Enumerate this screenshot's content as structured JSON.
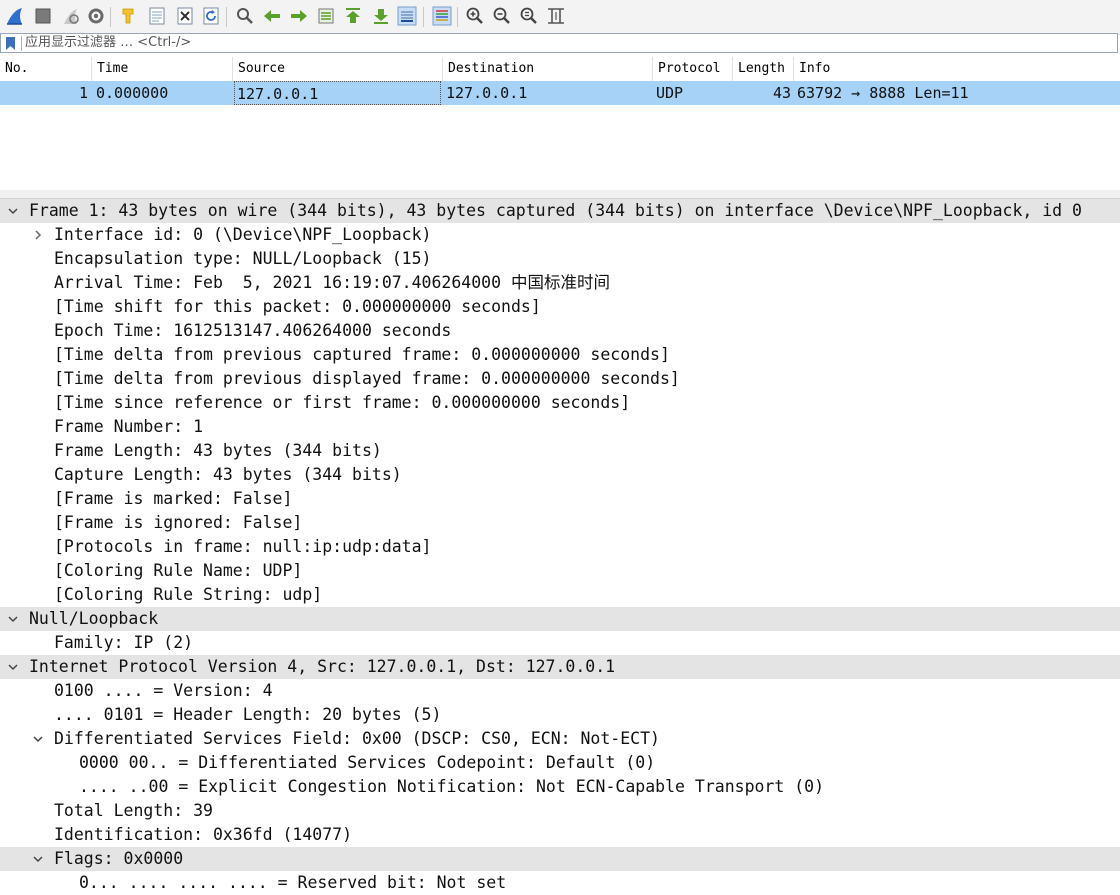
{
  "toolbar": {
    "buttons": [
      {
        "name": "start-capture-icon"
      },
      {
        "name": "stop-capture-icon"
      },
      {
        "name": "restart-capture-icon"
      },
      {
        "name": "capture-options-icon"
      },
      {
        "name": "open-file-icon"
      },
      {
        "name": "save-file-icon"
      },
      {
        "name": "close-file-icon"
      },
      {
        "name": "reload-file-icon"
      },
      {
        "name": "find-packet-icon"
      },
      {
        "name": "go-back-icon"
      },
      {
        "name": "go-forward-icon"
      },
      {
        "name": "go-to-packet-icon"
      },
      {
        "name": "go-first-packet-icon"
      },
      {
        "name": "go-last-packet-icon"
      },
      {
        "name": "auto-scroll-icon"
      },
      {
        "name": "colorize-icon"
      },
      {
        "name": "zoom-in-icon"
      },
      {
        "name": "zoom-out-icon"
      },
      {
        "name": "normal-size-icon"
      },
      {
        "name": "resize-columns-icon"
      }
    ]
  },
  "filter": {
    "placeholder": "应用显示过滤器 … <Ctrl-/>"
  },
  "packet_list": {
    "columns": [
      "No.",
      "Time",
      "Source",
      "Destination",
      "Protocol",
      "Length",
      "Info"
    ],
    "rows": [
      {
        "no": "1",
        "time": "0.000000",
        "source": "127.0.0.1",
        "destination": "127.0.0.1",
        "protocol": "UDP",
        "length": "43",
        "info": "63792 → 8888 Len=11"
      }
    ],
    "selected_color": "#a6d2f7"
  },
  "details": {
    "lines": [
      {
        "text": "Frame 1: 43 bytes on wire (344 bits), 43 bytes captured (344 bits) on interface \\Device\\NPF_Loopback, id 0",
        "arrow": "expanded",
        "level": 0,
        "hl": true
      },
      {
        "text": "Interface id: 0 (\\Device\\NPF_Loopback)",
        "arrow": "collapsed",
        "level": 1
      },
      {
        "text": "Encapsulation type: NULL/Loopback (15)",
        "level": 1
      },
      {
        "text": "Arrival Time: Feb  5, 2021 16:19:07.406264000 ",
        "suffix": "中国标准时间",
        "level": 1
      },
      {
        "text": "[Time shift for this packet: 0.000000000 seconds]",
        "level": 1
      },
      {
        "text": "Epoch Time: 1612513147.406264000 seconds",
        "level": 1
      },
      {
        "text": "[Time delta from previous captured frame: 0.000000000 seconds]",
        "level": 1
      },
      {
        "text": "[Time delta from previous displayed frame: 0.000000000 seconds]",
        "level": 1
      },
      {
        "text": "[Time since reference or first frame: 0.000000000 seconds]",
        "level": 1
      },
      {
        "text": "Frame Number: 1",
        "level": 1
      },
      {
        "text": "Frame Length: 43 bytes (344 bits)",
        "level": 1
      },
      {
        "text": "Capture Length: 43 bytes (344 bits)",
        "level": 1
      },
      {
        "text": "[Frame is marked: False]",
        "level": 1
      },
      {
        "text": "[Frame is ignored: False]",
        "level": 1
      },
      {
        "text": "[Protocols in frame: null:ip:udp:data]",
        "level": 1
      },
      {
        "text": "[Coloring Rule Name: UDP]",
        "level": 1
      },
      {
        "text": "[Coloring Rule String: udp]",
        "level": 1
      },
      {
        "text": "Null/Loopback",
        "arrow": "expanded",
        "level": 0,
        "hl": true
      },
      {
        "text": "Family: IP (2)",
        "level": 1
      },
      {
        "text": "Internet Protocol Version 4, Src: 127.0.0.1, Dst: 127.0.0.1",
        "arrow": "expanded",
        "level": 0,
        "hl": true
      },
      {
        "text": "0100 .... = Version: 4",
        "level": 1
      },
      {
        "text": ".... 0101 = Header Length: 20 bytes (5)",
        "level": 1
      },
      {
        "text": "Differentiated Services Field: 0x00 (DSCP: CS0, ECN: Not-ECT)",
        "arrow": "expanded",
        "level": 1
      },
      {
        "text": "0000 00.. = Differentiated Services Codepoint: Default (0)",
        "level": 2
      },
      {
        "text": ".... ..00 = Explicit Congestion Notification: Not ECN-Capable Transport (0)",
        "level": 2
      },
      {
        "text": "Total Length: 39",
        "level": 1
      },
      {
        "text": "Identification: 0x36fd (14077)",
        "level": 1
      },
      {
        "text": "Flags: 0x0000",
        "arrow": "expanded",
        "level": 1,
        "hl": true
      },
      {
        "text": "0... .... .... .... = Reserved bit: Not set",
        "level": 2
      }
    ]
  }
}
